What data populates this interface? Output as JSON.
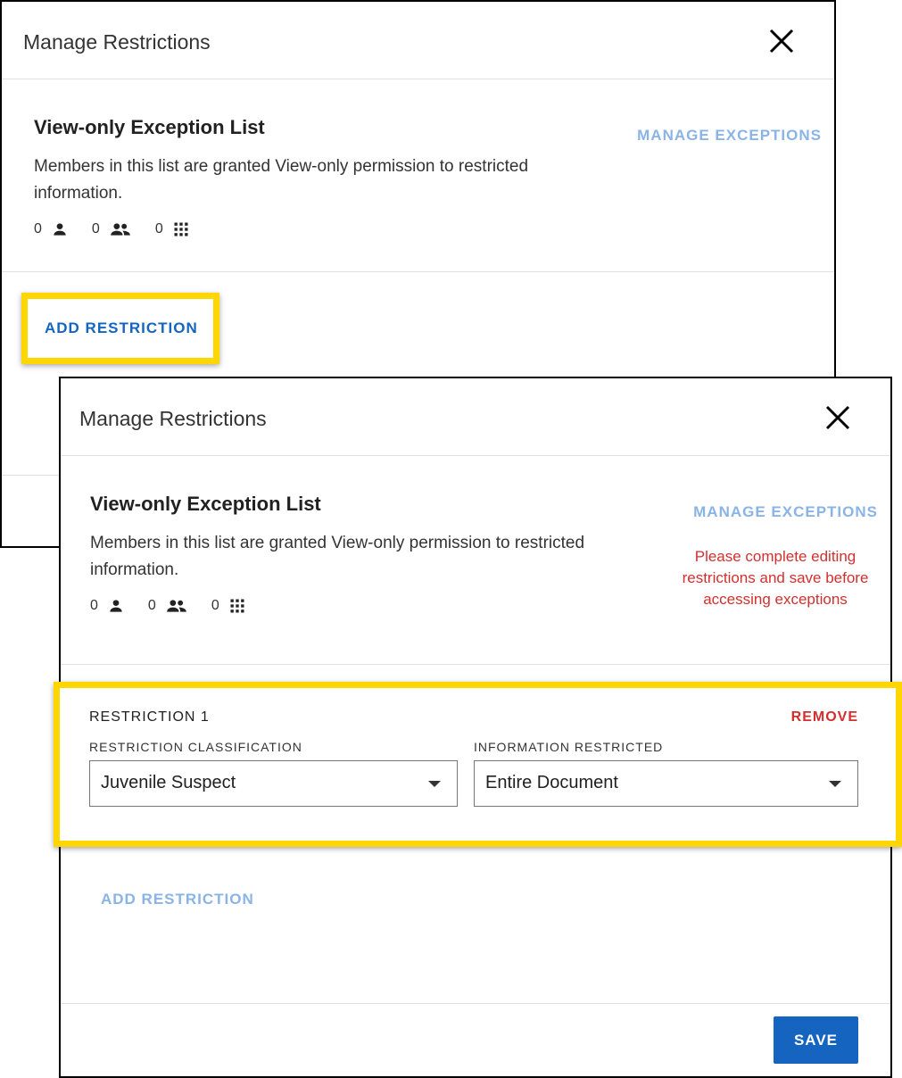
{
  "back_dialog": {
    "title": "Manage Restrictions",
    "section_title": "View-only Exception List",
    "description": "Members in this list are granted View-only permission to restricted information.",
    "counts": {
      "users": "0",
      "groups": "0",
      "apps": "0"
    },
    "manage_exceptions_label": "MANAGE EXCEPTIONS",
    "add_restriction_label": "ADD RESTRICTION"
  },
  "front_dialog": {
    "title": "Manage Restrictions",
    "section_title": "View-only Exception List",
    "description": "Members in this list are granted View-only permission to restricted information.",
    "counts": {
      "users": "0",
      "groups": "0",
      "apps": "0"
    },
    "manage_exceptions_label": "MANAGE EXCEPTIONS",
    "warning": "Please complete editing restrictions and save before accessing exceptions",
    "restriction": {
      "title": "RESTRICTION 1",
      "remove_label": "REMOVE",
      "classification_label": "RESTRICTION CLASSIFICATION",
      "classification_value": "Juvenile Suspect",
      "info_label": "INFORMATION RESTRICTED",
      "info_value": "Entire Document"
    },
    "add_restriction_label": "ADD RESTRICTION",
    "save_label": "SAVE"
  },
  "colors": {
    "highlight": "#ffd600",
    "primary": "#1565c0",
    "disabled_link": "#8ab4e6",
    "danger": "#d32f2f"
  }
}
